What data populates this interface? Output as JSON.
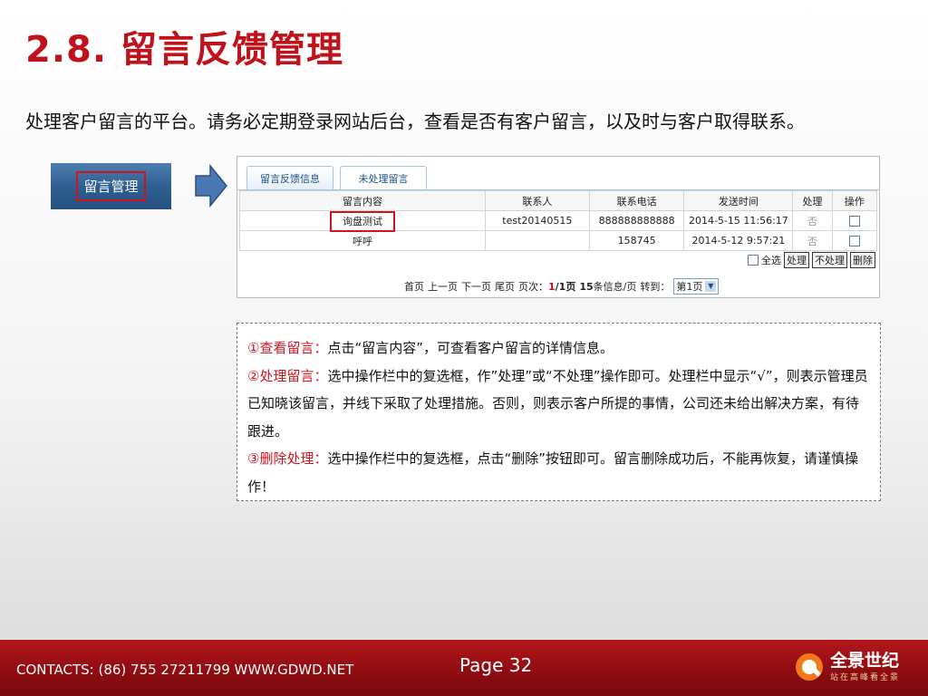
{
  "slide": {
    "title": "2.8. 留言反馈管理",
    "intro": "处理客户留言的平台。请务必定期登录网站后台，查看是否有客户留言，以及时与客户取得联系。"
  },
  "menu_button": {
    "label": "留言管理"
  },
  "admin_panel": {
    "tabs": [
      "留言反馈信息",
      "未处理留言"
    ],
    "columns": [
      "留言内容",
      "联系人",
      "联系电话",
      "发送时间",
      "处理",
      "操作"
    ],
    "rows": [
      {
        "content": "询盘测试",
        "contact": "test20140515",
        "phone": "888888888888",
        "time": "2014-5-15 11:56:17",
        "handled": "否"
      },
      {
        "content": "呼呼",
        "contact": "",
        "phone": "158745",
        "time": "2014-5-12 9:57:21",
        "handled": "否"
      }
    ],
    "select_all_label": "全选",
    "process_button": "处理",
    "unprocess_button": "不处理",
    "delete_button": "删除",
    "pager": {
      "first": "首页",
      "prev": "上一页",
      "next": "下一页",
      "last": "尾页",
      "page_label": "页次：",
      "current": "1",
      "total": "/1页",
      "per_page_count": "15",
      "per_page_suffix": "条信息/页",
      "goto": "转到：",
      "select_value": "第1页"
    }
  },
  "notes": {
    "item1_label": "①查看留言：",
    "item1_text": "点击“留言内容”，可查看客户留言的详情信息。",
    "item2_label": "②处理留言：",
    "item2_text": "选中操作栏中的复选框，作”处理”或“不处理”操作即可。处理栏中显示“√”，则表示管理员已知晓该留言，并线下采取了处理措施。否则，则表示客户所提的事情，公司还未给出解决方案，有待跟进。",
    "item3_label": "③删除处理：",
    "item3_text": "选中操作栏中的复选框，点击“删除”按钮即可。留言删除成功后，不能再恢复，请谨慎操作！"
  },
  "footer": {
    "contacts": "CONTACTS: (86) 755 27211799 WWW.GDWD.NET",
    "page": "Page 32",
    "logo_name": "全景世纪",
    "logo_tagline": "站在高峰看全景"
  },
  "colors": {
    "title_red": "#c0121a",
    "footer_red": "#a01015",
    "highlight_red": "#d0141d",
    "button_blue": "#2f5f92"
  }
}
